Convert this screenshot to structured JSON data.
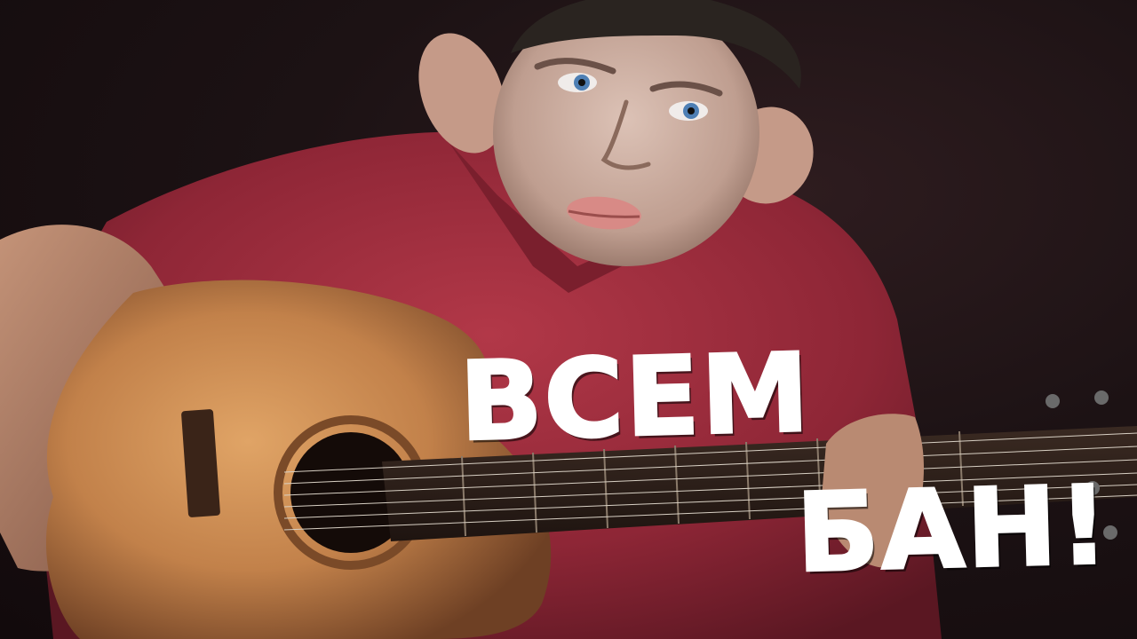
{
  "caption": {
    "line1": "ВСЕМ",
    "line2": "БАН!"
  },
  "colors": {
    "background": "#1a1113",
    "shirt": "#9c2c3c",
    "guitar_body": "#c98a4e",
    "skin": "#cdb1a4",
    "caption_text": "#ffffff"
  }
}
